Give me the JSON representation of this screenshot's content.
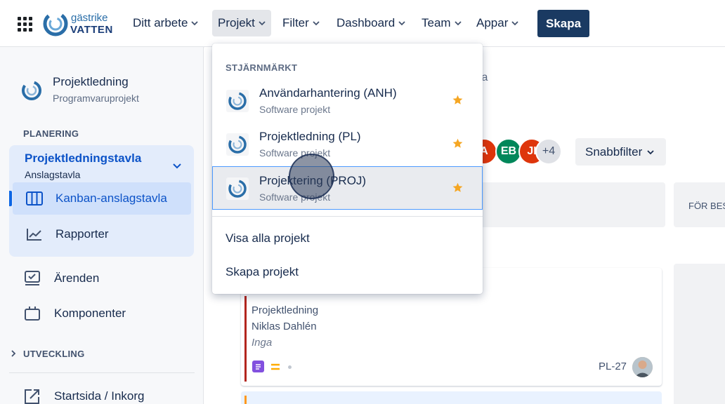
{
  "topnav": {
    "logo": {
      "line1": "gästrike",
      "line2": "VATTEN"
    },
    "items": [
      {
        "label": "Ditt arbete"
      },
      {
        "label": "Projekt"
      },
      {
        "label": "Filter"
      },
      {
        "label": "Dashboard"
      },
      {
        "label": "Team"
      },
      {
        "label": "Appar"
      }
    ],
    "create_label": "Skapa"
  },
  "sidebar": {
    "project_name": "Projektledning",
    "project_type": "Programvaruprojekt",
    "planning_label": "PLANERING",
    "board": {
      "title": "Projektledningstavla",
      "subtitle": "Anslagstavla",
      "items": [
        {
          "label": "Kanban-anslagstavla"
        },
        {
          "label": "Rapporter"
        }
      ]
    },
    "items": [
      {
        "label": "Ärenden"
      },
      {
        "label": "Komponenter"
      }
    ],
    "development_label": "UTVECKLING",
    "bottom_item": "Startsida / Inkorg"
  },
  "main": {
    "breadcrumb_fragment": "la",
    "avatars": [
      {
        "initials": "A",
        "color": "#de350b"
      },
      {
        "initials": "EB",
        "color": "#00875a"
      },
      {
        "initials": "JI",
        "color": "#de350b"
      },
      {
        "initials": "+4",
        "color": "#dfe1e6"
      }
    ],
    "quick_filter_label": "Snabbfilter",
    "column_header_fragment": "FÖR BES",
    "card": {
      "line1": "Projektledning",
      "line2": "Niklas Dahlén",
      "line3": "Inga",
      "key": "PL-27"
    }
  },
  "dropdown": {
    "heading": "STJÄRNMÄRKT",
    "projects": [
      {
        "title": "Användarhantering (ANH)",
        "subtitle": "Software projekt"
      },
      {
        "title": "Projektledning (PL)",
        "subtitle": "Software projekt"
      },
      {
        "title": "Projektering (PROJ)",
        "subtitle": "Software projekt"
      }
    ],
    "view_all": "Visa alla projekt",
    "create_project": "Skapa projekt"
  },
  "colors": {
    "accent": "#0c53c8",
    "create_button": "#1a3a62",
    "star": "#f5a623"
  }
}
